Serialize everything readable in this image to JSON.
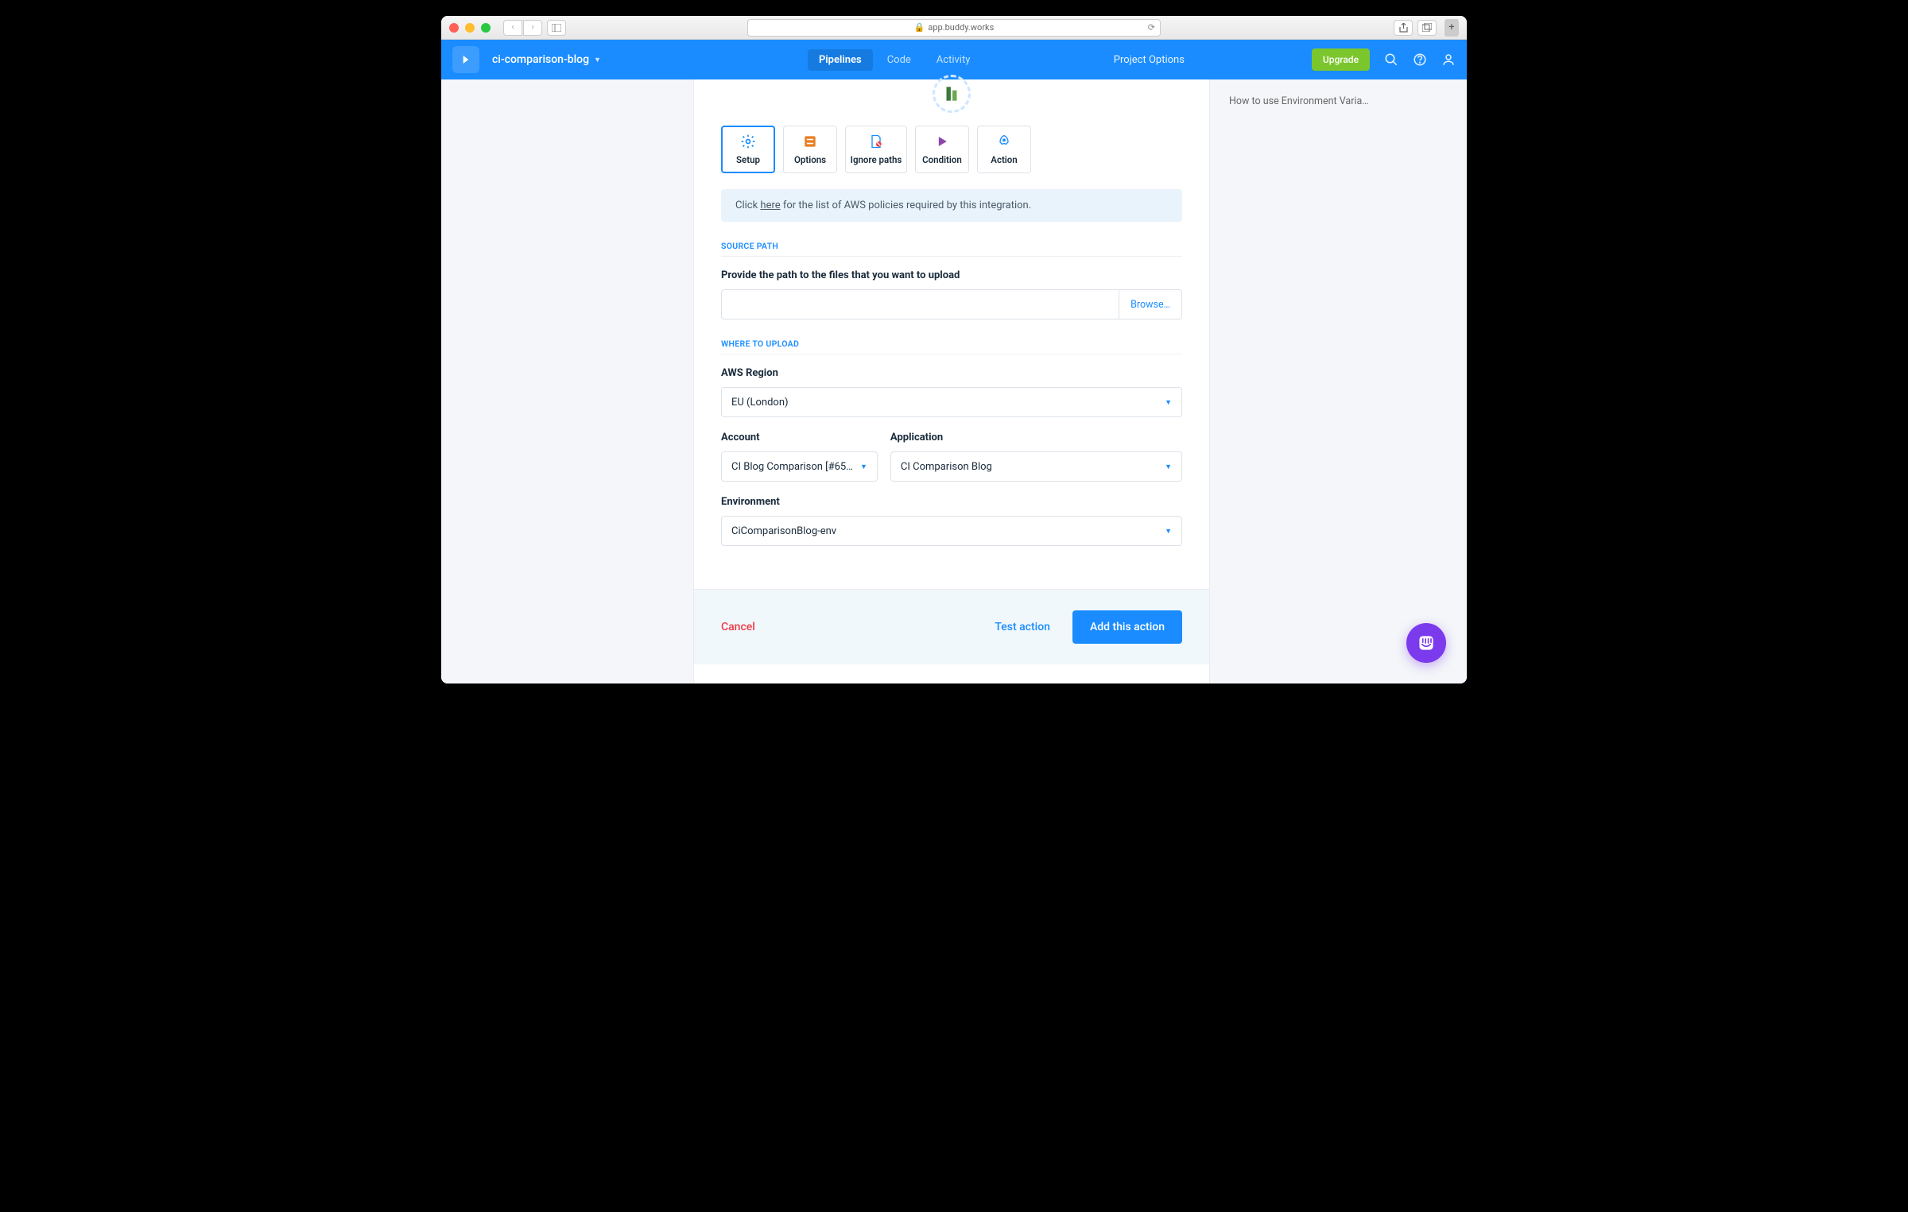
{
  "browser": {
    "url_host": "app.buddy.works"
  },
  "topbar": {
    "project": "ci-comparison-blog",
    "tabs": {
      "pipelines": "Pipelines",
      "code": "Code",
      "activity": "Activity"
    },
    "project_options": "Project Options",
    "upgrade": "Upgrade"
  },
  "sidebar_link": "How to use Environment Varia…",
  "action_tabs": {
    "setup": "Setup",
    "options": "Options",
    "ignore": "Ignore paths",
    "condition": "Condition",
    "action": "Action"
  },
  "banner": {
    "prefix": "Click ",
    "link": "here",
    "suffix": " for the list of AWS policies required by this integration."
  },
  "source_path": {
    "title": "SOURCE PATH",
    "label": "Provide the path to the files that you want to upload",
    "value": "",
    "browse": "Browse…"
  },
  "upload": {
    "title": "WHERE TO UPLOAD",
    "region_label": "AWS Region",
    "region_value": "EU (London)",
    "account_label": "Account",
    "account_value": "CI Blog Comparison [#65…",
    "app_label": "Application",
    "app_value": "CI Comparison Blog",
    "env_label": "Environment",
    "env_value": "CiComparisonBlog-env"
  },
  "footer": {
    "cancel": "Cancel",
    "test": "Test action",
    "add": "Add this action"
  }
}
